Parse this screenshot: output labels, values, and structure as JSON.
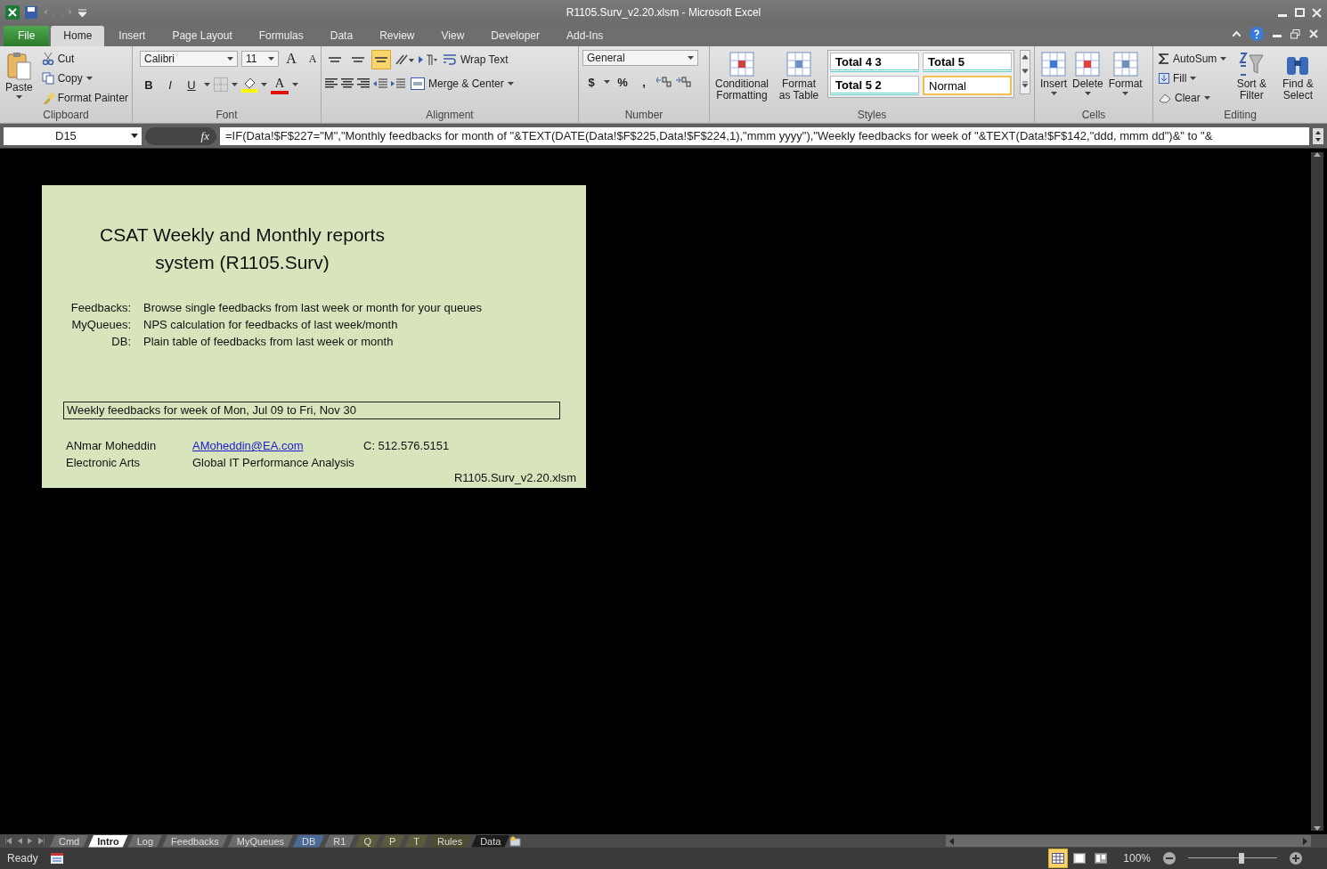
{
  "window": {
    "title": "R1105.Surv_v2.20.xlsm  -  Microsoft Excel"
  },
  "ribbon": {
    "tabs": [
      {
        "label": "File",
        "kind": "file",
        "selected": false
      },
      {
        "label": "Home",
        "kind": "tab",
        "selected": true
      },
      {
        "label": "Insert",
        "kind": "tab",
        "selected": false
      },
      {
        "label": "Page Layout",
        "kind": "tab",
        "selected": false
      },
      {
        "label": "Formulas",
        "kind": "tab",
        "selected": false
      },
      {
        "label": "Data",
        "kind": "tab",
        "selected": false
      },
      {
        "label": "Review",
        "kind": "tab",
        "selected": false
      },
      {
        "label": "View",
        "kind": "tab",
        "selected": false
      },
      {
        "label": "Developer",
        "kind": "tab",
        "selected": false
      },
      {
        "label": "Add-Ins",
        "kind": "tab",
        "selected": false
      }
    ],
    "clipboard": {
      "label": "Clipboard",
      "paste": "Paste",
      "small": [
        "Cut",
        "Copy",
        "Format Painter"
      ]
    },
    "font": {
      "label": "Font",
      "font_name": "Calibri",
      "font_size": "11",
      "grow": "A",
      "shrink": "A",
      "styles": [
        "B",
        "I",
        "U"
      ],
      "font_color": "A"
    },
    "alignment": {
      "label": "Alignment",
      "vertical": [
        {
          "selected": false
        },
        {
          "selected": false
        },
        {
          "selected": true
        }
      ],
      "wrap": "Wrap Text",
      "merge": "Merge & Center"
    },
    "number": {
      "label": "Number",
      "format": "General",
      "symbols": [
        "$",
        "%",
        ","
      ]
    },
    "styles": {
      "label": "Styles",
      "commands": [
        "Conditional Formatting",
        "Format as Table"
      ],
      "cells": [
        {
          "label": "Total 4 3",
          "selected": false
        },
        {
          "label": "Total 5",
          "selected": false
        },
        {
          "label": "Total 5 2",
          "selected": false
        },
        {
          "label": "Normal",
          "selected": true
        }
      ]
    },
    "cells": {
      "label": "Cells",
      "commands": [
        "Insert",
        "Delete",
        "Format"
      ]
    },
    "editing": {
      "label": "Editing",
      "small": [
        "AutoSum",
        "Fill",
        "Clear"
      ],
      "commands": [
        "Sort & Filter",
        "Find & Select"
      ]
    }
  },
  "formula_bar": {
    "name_box": "D15",
    "fx": "fx",
    "formula": "=IF(Data!$F$227=\"M\",\"Monthly feedbacks for month of \"&TEXT(DATE(Data!$F$225,Data!$F$224,1),\"mmm yyyy\"),\"Weekly feedbacks for week of \"&TEXT(Data!$F$142,\"ddd, mmm dd\")&\" to \"&"
  },
  "sheet": {
    "title": [
      "CSAT Weekly and Monthly reports",
      "system (R1105.Surv)"
    ],
    "rows": [
      {
        "label": "Feedbacks:",
        "text": "Browse single feedbacks from last week or month for your queues"
      },
      {
        "label": "MyQueues:",
        "text": "NPS calculation for feedbacks of last week/month"
      },
      {
        "label": "DB:",
        "text": "Plain table of feedbacks from last week or month"
      }
    ],
    "active_cell": "Weekly feedbacks for week of Mon, Jul 09 to Fri, Nov 30",
    "contact": [
      {
        "name": "ANmar Moheddin",
        "email": "AMoheddin@EA.com",
        "phone": "C: 512.576.5151"
      },
      {
        "name": "Electronic Arts",
        "team": "Global IT Performance Analysis"
      }
    ],
    "file_name": "R1105.Surv_v2.20.xlsm"
  },
  "sheet_tabs": [
    {
      "label": "Cmd",
      "selected": false,
      "color": "#6a6a6a"
    },
    {
      "label": "Intro",
      "selected": true,
      "color": "#ffffff"
    },
    {
      "label": "Log",
      "selected": false,
      "color": "#6a6a6a"
    },
    {
      "label": "Feedbacks",
      "selected": false,
      "color": "#6a6a6a"
    },
    {
      "label": "MyQueues",
      "selected": false,
      "color": "#6a6a6a"
    },
    {
      "label": "DB",
      "selected": false,
      "color": "#4c6a96"
    },
    {
      "label": "R1",
      "selected": false,
      "color": "#6a6a6a"
    },
    {
      "label": "Q",
      "selected": false,
      "color": "#5b5a3a"
    },
    {
      "label": "P",
      "selected": false,
      "color": "#5b5a3a"
    },
    {
      "label": "T",
      "selected": false,
      "color": "#5b5a3a"
    },
    {
      "label": "Rules",
      "selected": false,
      "color": "#4d4c30"
    },
    {
      "label": "Data",
      "selected": false,
      "color": "#1c1c1c"
    }
  ],
  "status_bar": {
    "status": "Ready",
    "views": [
      {
        "selected": true
      },
      {
        "selected": false
      },
      {
        "selected": false
      }
    ],
    "zoom": "100%",
    "zoom_slider": {
      "level": 0.6
    }
  }
}
